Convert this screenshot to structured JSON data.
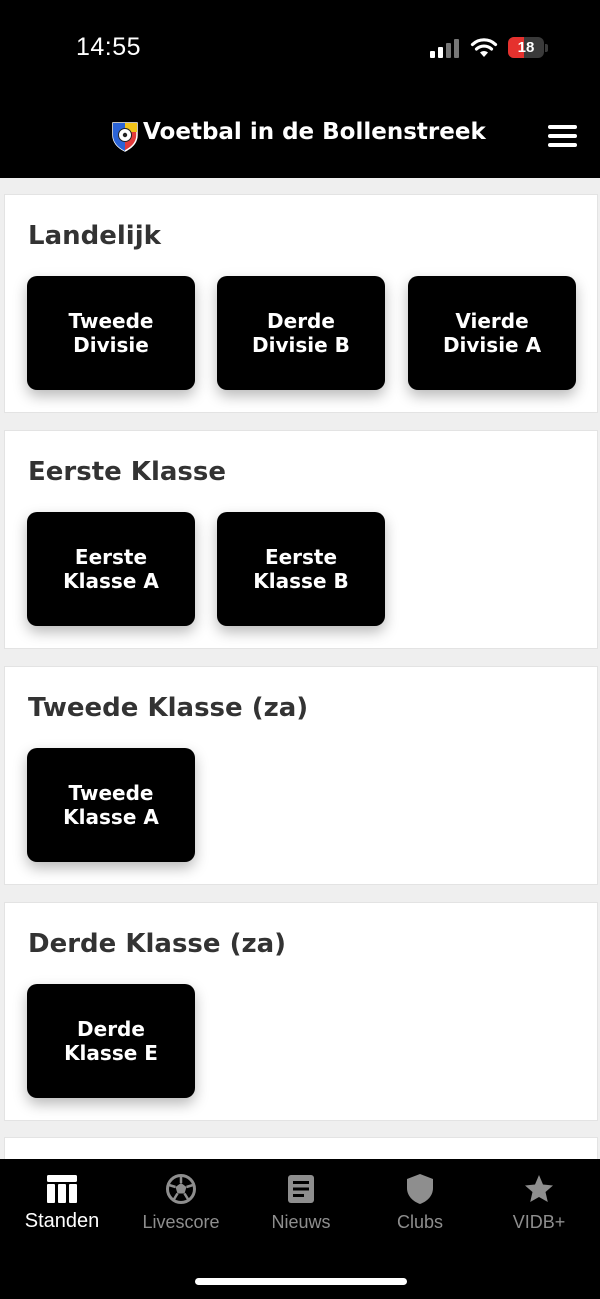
{
  "status_bar": {
    "time": "14:55",
    "battery": "18"
  },
  "header": {
    "title": "Voetbal in de Bollenstreek"
  },
  "sections": [
    {
      "title": "Landelijk",
      "buttons": [
        "Tweede\nDivisie",
        "Derde\nDivisie B",
        "Vierde\nDivisie A"
      ]
    },
    {
      "title": "Eerste Klasse",
      "buttons": [
        "Eerste\nKlasse A",
        "Eerste\nKlasse B"
      ]
    },
    {
      "title": "Tweede Klasse (za)",
      "buttons": [
        "Tweede\nKlasse A"
      ]
    },
    {
      "title": "Derde Klasse (za)",
      "buttons": [
        "Derde\nKlasse E"
      ]
    }
  ],
  "tabs": [
    {
      "label": "Standen",
      "icon": "table-icon",
      "active": true
    },
    {
      "label": "Livescore",
      "icon": "soccer-ball-icon",
      "active": false
    },
    {
      "label": "Nieuws",
      "icon": "news-icon",
      "active": false
    },
    {
      "label": "Clubs",
      "icon": "shield-icon",
      "active": false
    },
    {
      "label": "VIDB+",
      "icon": "star-icon",
      "active": false
    }
  ],
  "colors": {
    "background": "#efefef",
    "bar": "#000000",
    "active_tab": "#ffffff",
    "inactive_tab": "#8e8e8e",
    "battery_low": "#e5312e"
  }
}
